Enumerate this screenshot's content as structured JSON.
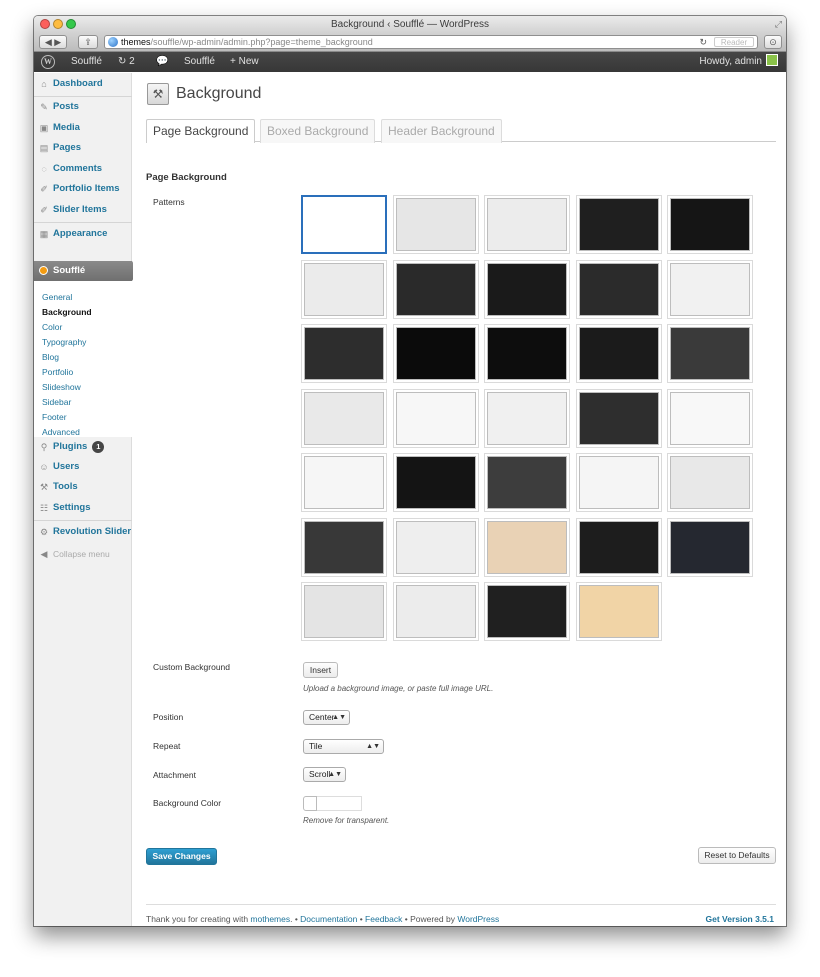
{
  "window": {
    "title": "Background ‹ Soufflé — WordPress",
    "url_host": "themes",
    "url_path": "/souffle/wp-admin/admin.php?page=theme_background",
    "reader_label": "Reader"
  },
  "adminbar": {
    "site_name": "Soufflé",
    "updates_count": "2",
    "new_label": "New",
    "howdy": "Howdy, admin"
  },
  "sidebar": {
    "items": [
      {
        "label": "Dashboard",
        "icon": "dashboard-icon"
      },
      {
        "label": "Posts",
        "icon": "posts-icon"
      },
      {
        "label": "Media",
        "icon": "media-icon"
      },
      {
        "label": "Pages",
        "icon": "pages-icon"
      },
      {
        "label": "Comments",
        "icon": "comments-icon"
      },
      {
        "label": "Portfolio Items",
        "icon": "portfolio-icon"
      },
      {
        "label": "Slider Items",
        "icon": "slider-icon"
      },
      {
        "label": "Appearance",
        "icon": "appearance-icon"
      },
      {
        "label": "Soufflé",
        "icon": "souffle-icon"
      },
      {
        "label": "Plugins",
        "icon": "plugins-icon",
        "badge": "1"
      },
      {
        "label": "Users",
        "icon": "users-icon"
      },
      {
        "label": "Tools",
        "icon": "tools-icon"
      },
      {
        "label": "Settings",
        "icon": "settings-icon"
      },
      {
        "label": "Revolution Slider",
        "icon": "revolution-icon"
      },
      {
        "label": "Collapse menu",
        "icon": "collapse-icon"
      }
    ],
    "submenu": [
      "General",
      "Background",
      "Color",
      "Typography",
      "Blog",
      "Portfolio",
      "Slideshow",
      "Sidebar",
      "Footer",
      "Advanced"
    ],
    "current_submenu": "Background"
  },
  "page": {
    "title": "Background",
    "tabs": [
      "Page Background",
      "Boxed Background",
      "Header Background"
    ],
    "active_tab": "Page Background",
    "section_title": "Page Background",
    "patterns_label": "Patterns",
    "patterns": [
      "#ffffff",
      "#e6e6e6",
      "#ececec",
      "#1f1f1f",
      "#151515",
      "#ebebeb",
      "#2a2a2a",
      "#1a1a1a",
      "#2b2b2b",
      "#f1f1f1",
      "#2d2d2d",
      "#0b0b0b",
      "#0d0d0d",
      "#1b1b1b",
      "#3a3a3a",
      "#e9e9e9",
      "#f7f7f7",
      "#f0f0f0",
      "#2e2e2e",
      "#f8f8f8",
      "#f6f6f6",
      "#141414",
      "#3d3d3d",
      "#f5f5f5",
      "#e8e8e8",
      "#383838",
      "#eeeeee",
      "#e9d2b5",
      "#1d1d1d",
      "#252830",
      "#e4e4e4",
      "#ececec",
      "#202020",
      "#f1d4a6"
    ],
    "selected_pattern_index": 0,
    "custom_bg_label": "Custom Background",
    "insert_label": "Insert",
    "custom_bg_hint": "Upload a background image, or paste full image URL.",
    "position_label": "Position",
    "position_value": "Center",
    "repeat_label": "Repeat",
    "repeat_value": "Tile",
    "attachment_label": "Attachment",
    "attachment_value": "Scroll",
    "bgcolor_label": "Background Color",
    "bgcolor_hint": "Remove for transparent.",
    "save_label": "Save Changes",
    "reset_label": "Reset to Defaults"
  },
  "footer": {
    "thanks": "Thank you for creating with ",
    "mothemes": "mothemes",
    "sep1": ". • ",
    "documentation": "Documentation",
    "sep2": " • ",
    "feedback": "Feedback",
    "sep3": " • Powered by ",
    "wordpress": "WordPress",
    "version": "Get Version 3.5.1"
  },
  "colors": {
    "link": "#21759b",
    "selected_border": "#2a6fbb",
    "adminbar": "#3f3f3f",
    "primary_button": "#21759b"
  }
}
